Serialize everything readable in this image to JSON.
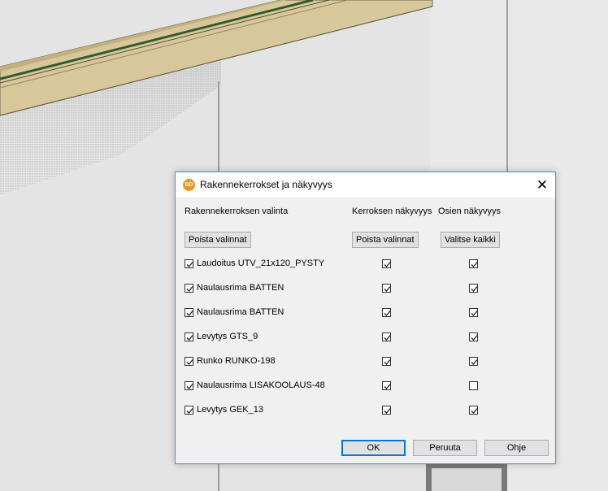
{
  "dialog": {
    "title": "Rakennekerrokset ja näkyvyys",
    "app_icon_text": "BD",
    "close_symbol": "✕",
    "headers": {
      "selection": "Rakennekerroksen valinta",
      "layer_visibility": "Kerroksen näkyvyys",
      "part_visibility": "Osien näkyvyys"
    },
    "buttons": {
      "clear_selection": "Poista valinnat",
      "clear_layer_visibility": "Poista valinnat",
      "select_all": "Valitse kaikki",
      "ok": "OK",
      "cancel": "Peruuta",
      "help": "Ohje"
    },
    "layers": [
      {
        "name": "Laudoitus UTV_21x120_PYSTY",
        "selected": true,
        "layer_visible": true,
        "parts_visible": true
      },
      {
        "name": "Naulausrima BATTEN",
        "selected": true,
        "layer_visible": true,
        "parts_visible": true
      },
      {
        "name": "Naulausrima BATTEN",
        "selected": true,
        "layer_visible": true,
        "parts_visible": true
      },
      {
        "name": "Levytys GTS_9",
        "selected": true,
        "layer_visible": true,
        "parts_visible": true
      },
      {
        "name": "Runko RUNKO-198",
        "selected": true,
        "layer_visible": true,
        "parts_visible": true
      },
      {
        "name": "Naulausrima LISAKOOLAUS-48",
        "selected": true,
        "layer_visible": true,
        "parts_visible": false
      },
      {
        "name": "Levytys GEK_13",
        "selected": true,
        "layer_visible": true,
        "parts_visible": true
      }
    ]
  },
  "colors": {
    "dialog_bg": "#f0f0f0",
    "accent": "#0078d7",
    "dialog_border": "#5a8fd0",
    "wood": "#d8c79a",
    "wood_stripe": "#2e5a2e"
  }
}
